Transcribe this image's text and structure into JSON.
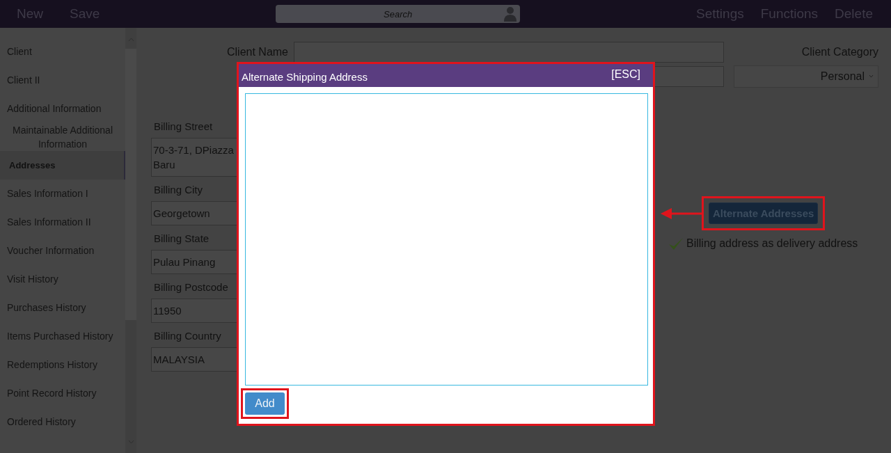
{
  "toolbar": {
    "left": [
      "New",
      "Save"
    ],
    "search": {
      "placeholder": "Search"
    },
    "right": [
      "Settings",
      "Functions",
      "Delete"
    ]
  },
  "sidebar": {
    "items": [
      {
        "label": "Client",
        "selected": false
      },
      {
        "label": "Client II",
        "selected": false
      },
      {
        "label": "Additional Information",
        "selected": false
      },
      {
        "label": "Maintainable Additional Information",
        "selected": false
      },
      {
        "label": "Addresses",
        "selected": true
      },
      {
        "label": "Sales Information I",
        "selected": false
      },
      {
        "label": "Sales Information II",
        "selected": false
      },
      {
        "label": "Voucher Information",
        "selected": false
      },
      {
        "label": "Visit History",
        "selected": false
      },
      {
        "label": "Purchases History",
        "selected": false
      },
      {
        "label": "Items Purchased History",
        "selected": false
      },
      {
        "label": "Redemptions History",
        "selected": false
      },
      {
        "label": "Point Record History",
        "selected": false
      },
      {
        "label": "Ordered History",
        "selected": false
      }
    ]
  },
  "form": {
    "client_name_label": "Client Name",
    "client_category": {
      "label": "Client Category",
      "value": "Personal"
    },
    "billing": [
      {
        "label": "Billing Street",
        "lines": [
          "70-3-71, DPiazza",
          "Baru"
        ]
      },
      {
        "label": "Billing City",
        "lines": [
          "Georgetown"
        ]
      },
      {
        "label": "Billing State",
        "lines": [
          "Pulau Pinang"
        ]
      },
      {
        "label": "Billing Postcode",
        "lines": [
          "11950"
        ]
      },
      {
        "label": "Billing Country",
        "lines": [
          "MALAYSIA"
        ]
      }
    ],
    "alternate_addresses_button": "Alternate Addresses",
    "delivery_option": {
      "label": "Billing address as delivery address",
      "checked": true
    }
  },
  "dialog": {
    "title": "Alternate Shipping Address",
    "close_hint": "[ESC]",
    "add_button": "Add"
  }
}
